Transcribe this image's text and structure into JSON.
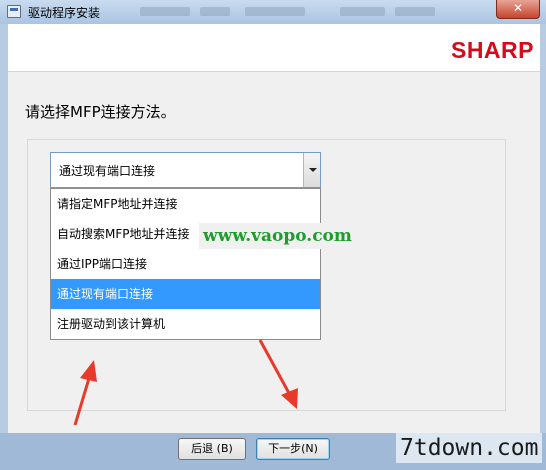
{
  "window": {
    "title": "驱动程序安装",
    "close_label": "✕"
  },
  "header": {
    "brand": "SHARP",
    "brand_color": "#d7091a"
  },
  "main": {
    "question": "请选择MFP连接方法。",
    "combo": {
      "selected": "通过现有端口连接",
      "options": [
        {
          "label": "请指定MFP地址并连接",
          "selected": false
        },
        {
          "label": "自动搜索MFP地址并连接",
          "selected": false
        },
        {
          "label": "通过IPP端口连接",
          "selected": false
        },
        {
          "label": "通过现有端口连接",
          "selected": true
        },
        {
          "label": "注册驱动到该计算机",
          "selected": false
        }
      ]
    }
  },
  "footer": {
    "back_label": "后退 (B)",
    "next_label": "下一步(N)"
  },
  "watermarks": {
    "middle": "www.vaopo.com",
    "corner": "7tdown.com"
  },
  "colors": {
    "selection": "#3399ff",
    "annotation_arrow": "#e8392a"
  }
}
